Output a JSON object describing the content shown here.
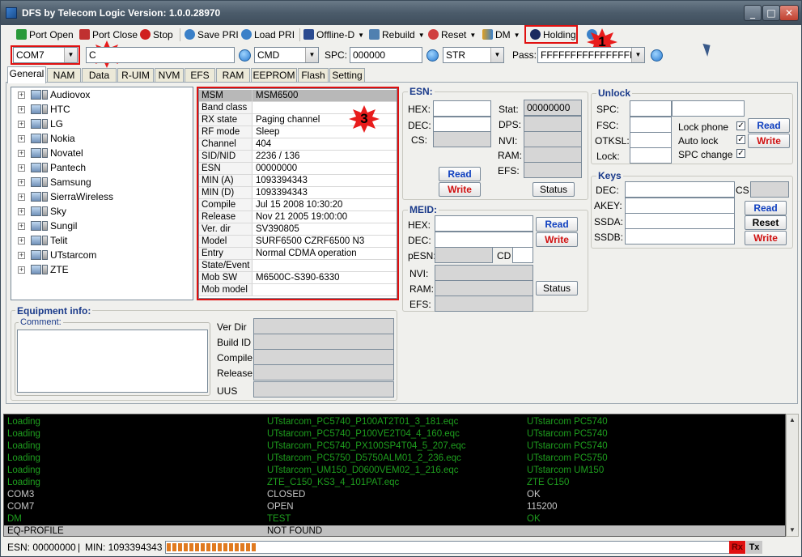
{
  "window": {
    "title": "DFS by Telecom Logic  Version: 1.0.0.28970",
    "min": "_",
    "max": "□",
    "close": "✕"
  },
  "toolbar": {
    "port_open": "Port Open",
    "port_close": "Port Close",
    "stop": "Stop",
    "save_pri": "Save PRI",
    "load_pri": "Load PRI",
    "offline_d": "Offline-D",
    "rebuild": "Rebuild",
    "reset": "Reset",
    "dm": "DM",
    "holding": "Holding"
  },
  "markers": [
    "1",
    "2",
    "3"
  ],
  "row2": {
    "com_port": "COM7",
    "com_field": "C",
    "mode": "CMD",
    "spc_label": "SPC:",
    "spc_value": "000000",
    "str_value": "STR",
    "pass_label": "Pass:",
    "pass_value": "FFFFFFFFFFFFFFFF"
  },
  "tabs": [
    "General",
    "NAM",
    "Data",
    "R-UIM",
    "NVM",
    "EFS",
    "RAM",
    "EEPROM",
    "Flash",
    "Setting"
  ],
  "brands": [
    "Audiovox",
    "HTC",
    "LG",
    "Nokia",
    "Novatel",
    "Pantech",
    "Samsung",
    "SierraWireless",
    "Sky",
    "Sungil",
    "Telit",
    "UTstarcom",
    "ZTE"
  ],
  "phone_info": [
    {
      "k": "MSM",
      "v": "MSM6500"
    },
    {
      "k": "Band class",
      "v": ""
    },
    {
      "k": "RX state",
      "v": "Paging  channel"
    },
    {
      "k": "RF mode",
      "v": "Sleep"
    },
    {
      "k": "Channel",
      "v": "404"
    },
    {
      "k": "SID/NID",
      "v": "2236 / 136"
    },
    {
      "k": "ESN",
      "v": "00000000"
    },
    {
      "k": "MIN (A)",
      "v": "1093394343"
    },
    {
      "k": "MIN (D)",
      "v": "1093394343"
    },
    {
      "k": "Compile",
      "v": "Jul 15 2008 10:30:20"
    },
    {
      "k": "Release",
      "v": "Nov 21 2005 19:00:00"
    },
    {
      "k": "Ver. dir",
      "v": "SV390805"
    },
    {
      "k": "Model",
      "v": "SURF6500  CZRF6500  N3"
    },
    {
      "k": "Entry",
      "v": "Normal  CDMA  operation"
    },
    {
      "k": "State/Event",
      "v": ""
    },
    {
      "k": "Mob SW rev",
      "v": "M6500C-S390-6330"
    },
    {
      "k": "Mob model",
      "v": ""
    }
  ],
  "esn": {
    "title": "ESN:",
    "hex": "HEX:",
    "dec": "DEC:",
    "cs": "CS:",
    "stat": "Stat:",
    "stat_value": "00000000",
    "dps": "DPS:",
    "nvi": "NVI:",
    "ram": "RAM:",
    "efs": "EFS:",
    "read": "Read",
    "write": "Write",
    "status": "Status"
  },
  "meid": {
    "title": "MEID:",
    "hex": "HEX:",
    "dec": "DEC:",
    "pesn": "pESN:",
    "cd": "CD",
    "nvi": "NVI:",
    "ram": "RAM:",
    "efs": "EFS:",
    "read": "Read",
    "write": "Write",
    "status": "Status"
  },
  "unlock": {
    "title": "Unlock",
    "spc": "SPC:",
    "fsc": "FSC:",
    "otksl": "OTKSL:",
    "lock": "Lock:",
    "lock_phone": "Lock phone",
    "auto_lock": "Auto lock",
    "spc_change": "SPC change",
    "check": "✓",
    "read": "Read",
    "write": "Write"
  },
  "keys": {
    "title": "Keys",
    "dec": "DEC:",
    "cs": "CS",
    "akey": "AKEY:",
    "ssda": "SSDA:",
    "ssdb": "SSDB:",
    "read": "Read",
    "reset": "Reset",
    "write": "Write"
  },
  "equipment": {
    "title": "Equipment info:",
    "comment": "Comment:",
    "ver_dir": "Ver Dir",
    "build_id": "Build ID",
    "compile": "Compile",
    "release": "Release",
    "uus": "UUS"
  },
  "log": [
    {
      "c1": "Loading",
      "c2": "UTstarcom_PC5740_P100AT2T01_3_181.eqc",
      "c3": "UTstarcom PC5740",
      "color": "#1e9e1e"
    },
    {
      "c1": "Loading",
      "c2": "UTstarcom_PC5740_P100VE2T04_4_160.eqc",
      "c3": "UTstarcom PC5740",
      "color": "#1e9e1e"
    },
    {
      "c1": "Loading",
      "c2": "UTstarcom_PC5740_PX100SP4T04_5_207.eqc",
      "c3": "UTstarcom PC5740",
      "color": "#1e9e1e"
    },
    {
      "c1": "Loading",
      "c2": "UTstarcom_PC5750_D5750ALM01_2_236.eqc",
      "c3": "UTstarcom PC5750",
      "color": "#1e9e1e"
    },
    {
      "c1": "Loading",
      "c2": "UTstarcom_UM150_D0600VEM02_1_216.eqc",
      "c3": "UTstarcom UM150",
      "color": "#1e9e1e"
    },
    {
      "c1": "Loading",
      "c2": "ZTE_C150_KS3_4_101PAT.eqc",
      "c3": "ZTE C150",
      "color": "#1e9e1e"
    },
    {
      "c1": "COM3",
      "c2": "CLOSED",
      "c3": "OK",
      "color": "#c8c8c8"
    },
    {
      "c1": "COM7",
      "c2": "OPEN",
      "c3": "115200",
      "color": "#c8c8c8"
    },
    {
      "c1": "DM",
      "c2": "TEST",
      "c3": "OK",
      "color": "#1e9e1e"
    },
    {
      "c1": "EQ-PROFILE",
      "c2": "NOT FOUND",
      "c3": "",
      "color": "#000000"
    }
  ],
  "statusbar": {
    "esn": "ESN:  00000000",
    "sep": "|",
    "min": "MIN:  1093394343",
    "progress": 0.16,
    "rx": "Rx",
    "tx": "Tx"
  }
}
